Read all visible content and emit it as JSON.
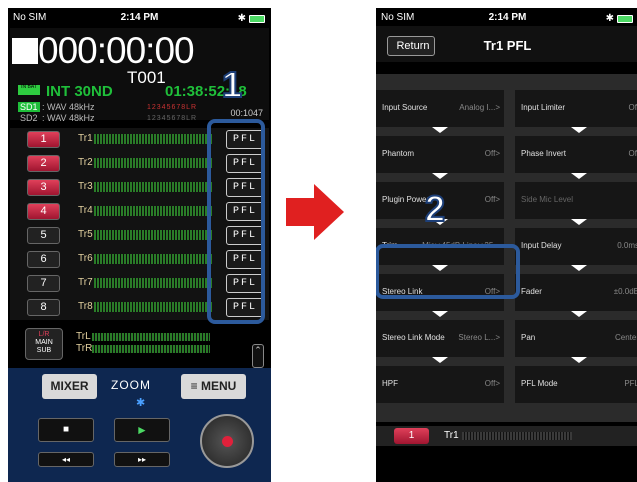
{
  "left": {
    "status": {
      "carrier": "No SIM",
      "time": "2:14 PM"
    },
    "display": {
      "timecode": "000:00:00",
      "take": "T001",
      "batt_label": "IN BAT",
      "source": "INT 30ND",
      "remain": "01:38:52:18",
      "sd1": {
        "tag": "SD1",
        "fmt": ": WAV 48kHz",
        "channels": "12345678LR"
      },
      "sd2": {
        "tag": "SD2",
        "fmt": ": WAV 48kHz",
        "channels": "12345678LR"
      },
      "count": "00:1047"
    },
    "tracks": [
      {
        "num": "1",
        "name": "Tr1",
        "armed": true,
        "pfl": "PFL"
      },
      {
        "num": "2",
        "name": "Tr2",
        "armed": true,
        "pfl": "PFL"
      },
      {
        "num": "3",
        "name": "Tr3",
        "armed": true,
        "pfl": "PFL"
      },
      {
        "num": "4",
        "name": "Tr4",
        "armed": true,
        "pfl": "PFL"
      },
      {
        "num": "5",
        "name": "Tr5",
        "armed": false,
        "pfl": "PFL"
      },
      {
        "num": "6",
        "name": "Tr6",
        "armed": false,
        "pfl": "PFL"
      },
      {
        "num": "7",
        "name": "Tr7",
        "armed": false,
        "pfl": "PFL"
      },
      {
        "num": "8",
        "name": "Tr8",
        "armed": false,
        "pfl": "PFL"
      }
    ],
    "lr": {
      "l1": "L/R",
      "l2": "MAIN",
      "l3": "SUB",
      "trl": "TrL",
      "trr": "TrR"
    },
    "controls": {
      "mixer": "MIXER",
      "menu": "≡ MENU",
      "logo": "ZOOM",
      "stop": "■",
      "play": "►",
      "rew": "◂◂",
      "ff": "▸▸"
    },
    "callout": "1"
  },
  "right": {
    "status": {
      "carrier": "No SIM",
      "time": "2:14 PM"
    },
    "nav": {
      "back": "Return",
      "title": "Tr1 PFL"
    },
    "left_col": [
      {
        "name": "Input Source",
        "value": "Analog I...>"
      },
      {
        "name": "Phantom",
        "value": "Off>"
      },
      {
        "name": "Plugin Power",
        "value": "Off>"
      },
      {
        "name": "Trim",
        "value": "Mic:+45dB Line:+25..."
      },
      {
        "name": "Stereo Link",
        "value": "Off>"
      },
      {
        "name": "Stereo Link Mode",
        "value": "Stereo L...>"
      },
      {
        "name": "HPF",
        "value": "Off>"
      }
    ],
    "right_col": [
      {
        "name": "Input Limiter",
        "value": "Off"
      },
      {
        "name": "Phase Invert",
        "value": "Off"
      },
      {
        "name": "Side Mic Level",
        "value": ""
      },
      {
        "name": "Input Delay",
        "value": "0.0ms"
      },
      {
        "name": "Fader",
        "value": "±0.0dB"
      },
      {
        "name": "Pan",
        "value": "Center"
      },
      {
        "name": "PFL Mode",
        "value": "PFL"
      }
    ],
    "track": {
      "num": "1",
      "name": "Tr1"
    },
    "callout": "2"
  }
}
